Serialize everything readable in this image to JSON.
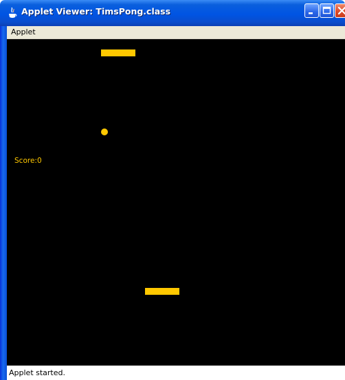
{
  "window": {
    "title": "Applet Viewer: TimsPong.class",
    "icon": "java-cup-icon"
  },
  "menu": {
    "items": [
      "Applet"
    ]
  },
  "game": {
    "score_text": "Score:0",
    "background": "#000000",
    "accent": "#ffc800"
  },
  "status": {
    "text": "Applet started."
  }
}
